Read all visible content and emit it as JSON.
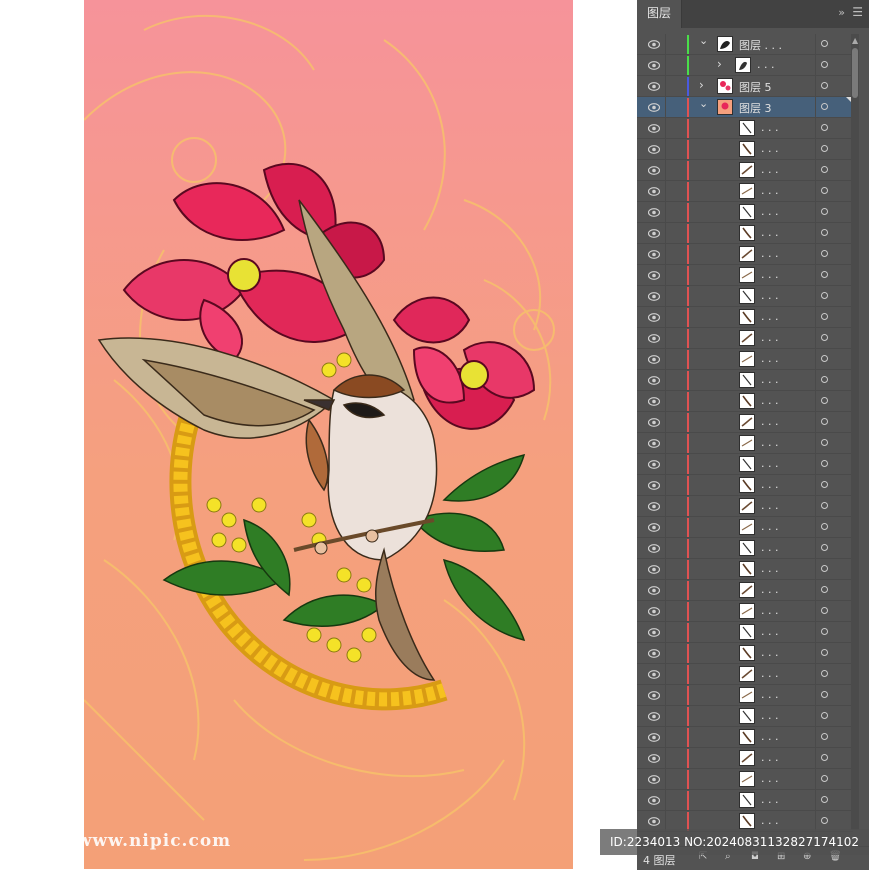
{
  "panel": {
    "tab_label": "图层",
    "collapse_icon": "double-chevron-right-icon",
    "menu_icon": "hamburger-menu-icon",
    "colors": {
      "green": "#4ade4a",
      "blue": "#4a5ae0",
      "red": "#e05252",
      "selected": "#46607a"
    }
  },
  "layers": [
    {
      "name": "图层 . . .",
      "level": 0,
      "expanded": true,
      "color": "green",
      "selected": false
    },
    {
      "name": ". . .",
      "level": 1,
      "expanded": false,
      "color": "green",
      "selected": false
    },
    {
      "name": "图层 5",
      "level": 0,
      "expanded": false,
      "color": "blue",
      "selected": false
    },
    {
      "name": "图层 3",
      "level": 0,
      "expanded": true,
      "color": "red",
      "selected": true
    }
  ],
  "sublayer_label": ". . .",
  "sublayer_count": 34,
  "footer": {
    "layer_count": "4 图层",
    "icons": [
      "export-icon",
      "locate-icon",
      "clip-mask-icon",
      "new-sublayer-icon",
      "new-layer-icon",
      "trash-icon"
    ]
  },
  "watermark": {
    "left": "昵图网 www.nipic.com",
    "right": "ID:2234013 NO:20240831132827174102"
  }
}
